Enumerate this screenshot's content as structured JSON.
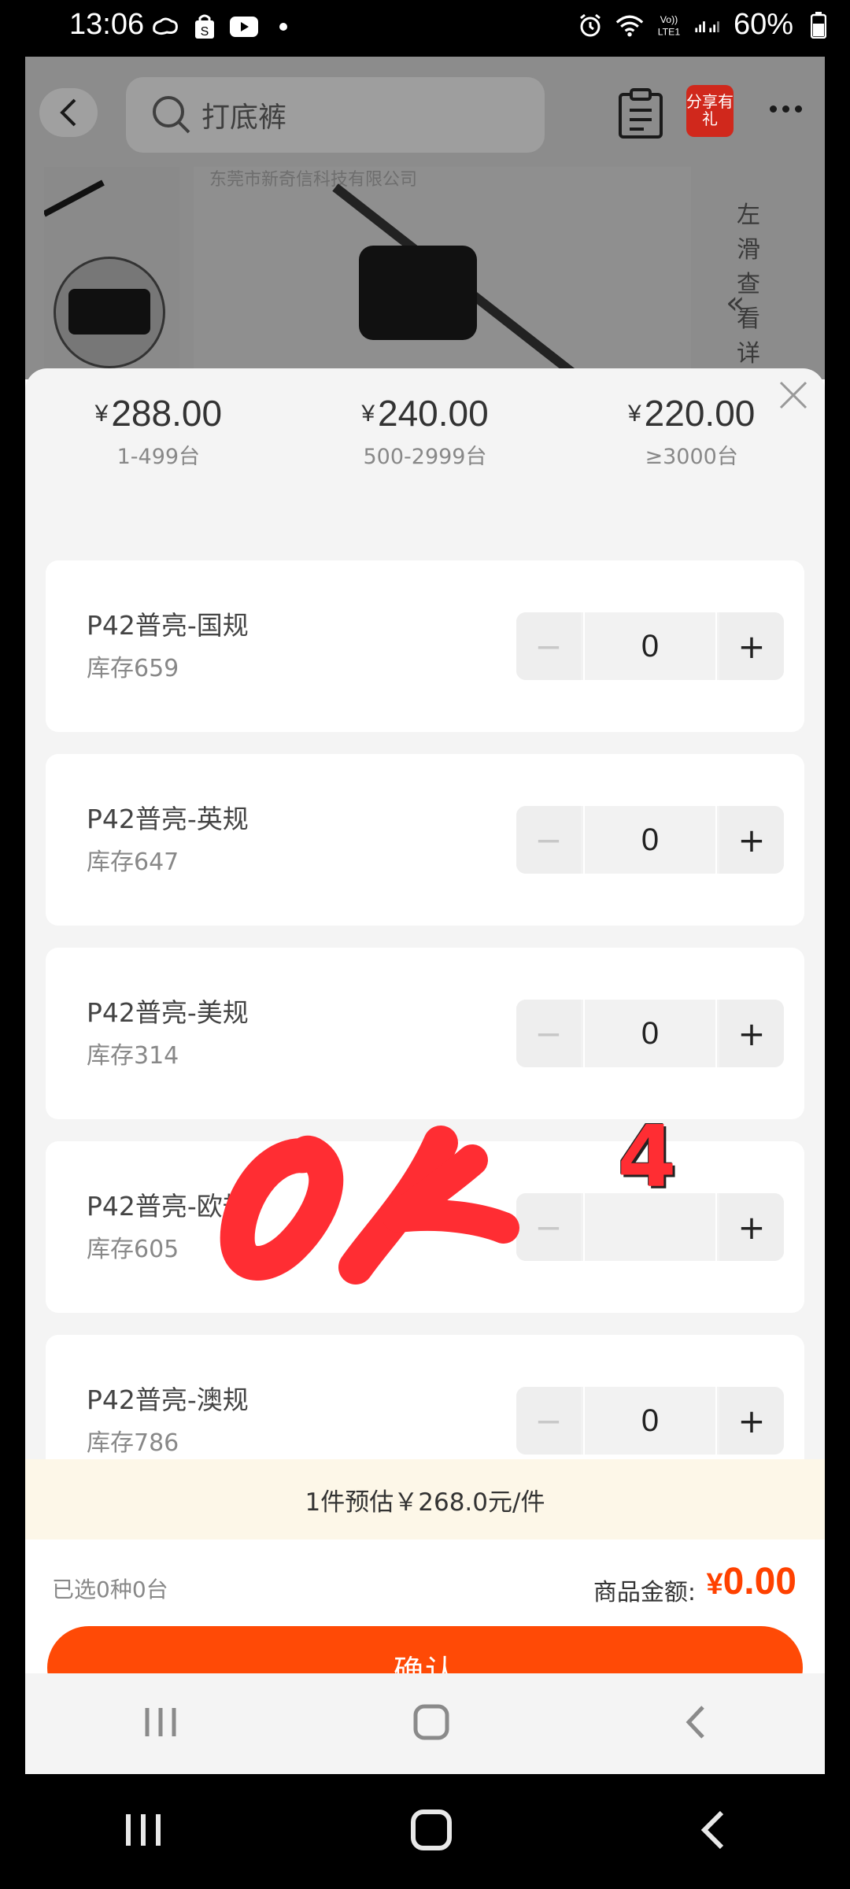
{
  "status_bar": {
    "time": "13:06",
    "battery": "60%",
    "icons": [
      "cloud-icon",
      "shopping-bag-icon",
      "youtube-icon",
      "dot-icon",
      "alarm-icon",
      "wifi-icon",
      "volte-icon",
      "signal-icon",
      "battery-icon"
    ]
  },
  "top_bar": {
    "search_placeholder": "打底裤",
    "share_badge": "分享有礼"
  },
  "product_image": {
    "watermark": "东莞市新奇信科技有限公司",
    "swipe_hint": "左滑查看详"
  },
  "price_tiers": [
    {
      "currency": "¥",
      "price": "288.00",
      "range": "1-499台"
    },
    {
      "currency": "¥",
      "price": "240.00",
      "range": "500-2999台"
    },
    {
      "currency": "¥",
      "price": "220.00",
      "range": "≥3000台"
    }
  ],
  "variants": [
    {
      "name": "P42普亮-国规",
      "stock": "库存659",
      "qty": "0"
    },
    {
      "name": "P42普亮-英规",
      "stock": "库存647",
      "qty": "0"
    },
    {
      "name": "P42普亮-美规",
      "stock": "库存314",
      "qty": "0"
    },
    {
      "name": "P42普亮-欧规",
      "stock": "库存605",
      "qty": ""
    },
    {
      "name": "P42普亮-澳规",
      "stock": "库存786",
      "qty": "0"
    }
  ],
  "stepper": {
    "minus": "−",
    "plus": "+"
  },
  "estimate": "1件预估￥268.0元/件",
  "summary": {
    "selected": "已选0种0台",
    "amount_label": "商品金额:",
    "currency": "¥",
    "amount": "0.00"
  },
  "confirm_label": "确认",
  "annotation": {
    "number": "4",
    "handwritten": "OK"
  },
  "colors": {
    "accent": "#ff4a06",
    "amount": "#ff4100",
    "annotation": "#ff2d33"
  }
}
